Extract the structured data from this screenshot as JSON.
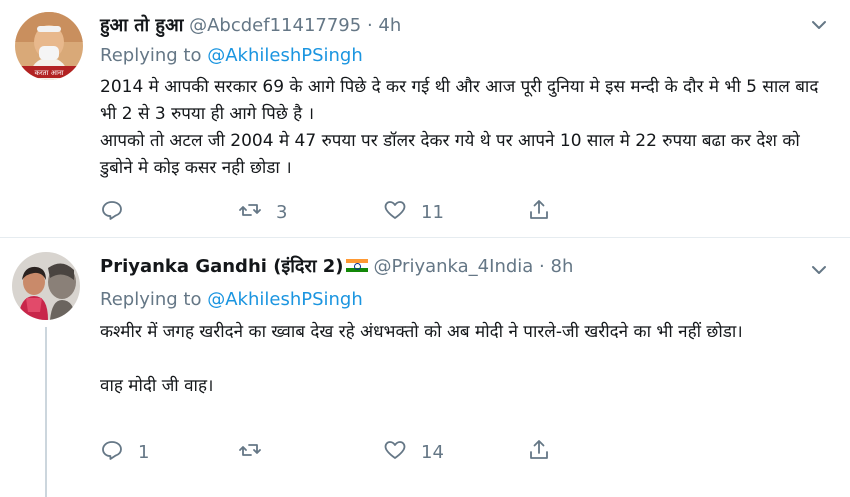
{
  "tweets": [
    {
      "display_name": "हुआ तो हुआ",
      "handle": "@Abcdef11417795",
      "separator": "·",
      "time": "4h",
      "replying_prefix": "Replying to",
      "replying_to": "@AkhileshPSingh",
      "paragraphs": [
        "2014 मे आपकी सरकार 69 के आगे पिछे दे कर गई थी और आज पूरी दुनिया मे इस मन्दी के दौर मे भी 5 साल बाद भी 2 से 3 रुपया ही आगे पिछे है ।",
        "आपको तो अटल जी 2004 मे 47 रुपया पर डॉलर देकर गये थे पर आपने 10 साल मे 22 रुपया बढा कर देश को डुबोने मे कोइ कसर नही छोडा ।"
      ],
      "avatar_caption": "करता आना",
      "reply_count": "",
      "retweet_count": "3",
      "like_count": "11",
      "icons": [
        "reply-icon",
        "retweet-icon",
        "like-icon",
        "share-icon",
        "chevron-down-icon"
      ]
    },
    {
      "display_name": "Priyanka Gandhi (इंदिरा 2)",
      "handle": "@Priyanka_4India",
      "separator": "·",
      "time": "8h",
      "replying_prefix": "Replying to",
      "replying_to": "@AkhileshPSingh",
      "paragraphs": [
        "कश्मीर में जगह खरीदने का ख्वाब देख रहे अंधभक्तो को अब मोदी ने पारले-जी खरीदने का भी नहीं छोडा।",
        "",
        "वाह मोदी जी वाह।"
      ],
      "reply_count": "1",
      "retweet_count": "",
      "like_count": "14",
      "flag_colors": [
        "#ff9933",
        "#ffffff",
        "#138808"
      ]
    }
  ],
  "colors": {
    "link": "#1b95e0",
    "secondary_text": "#657786",
    "divider": "#e6ecf0"
  }
}
